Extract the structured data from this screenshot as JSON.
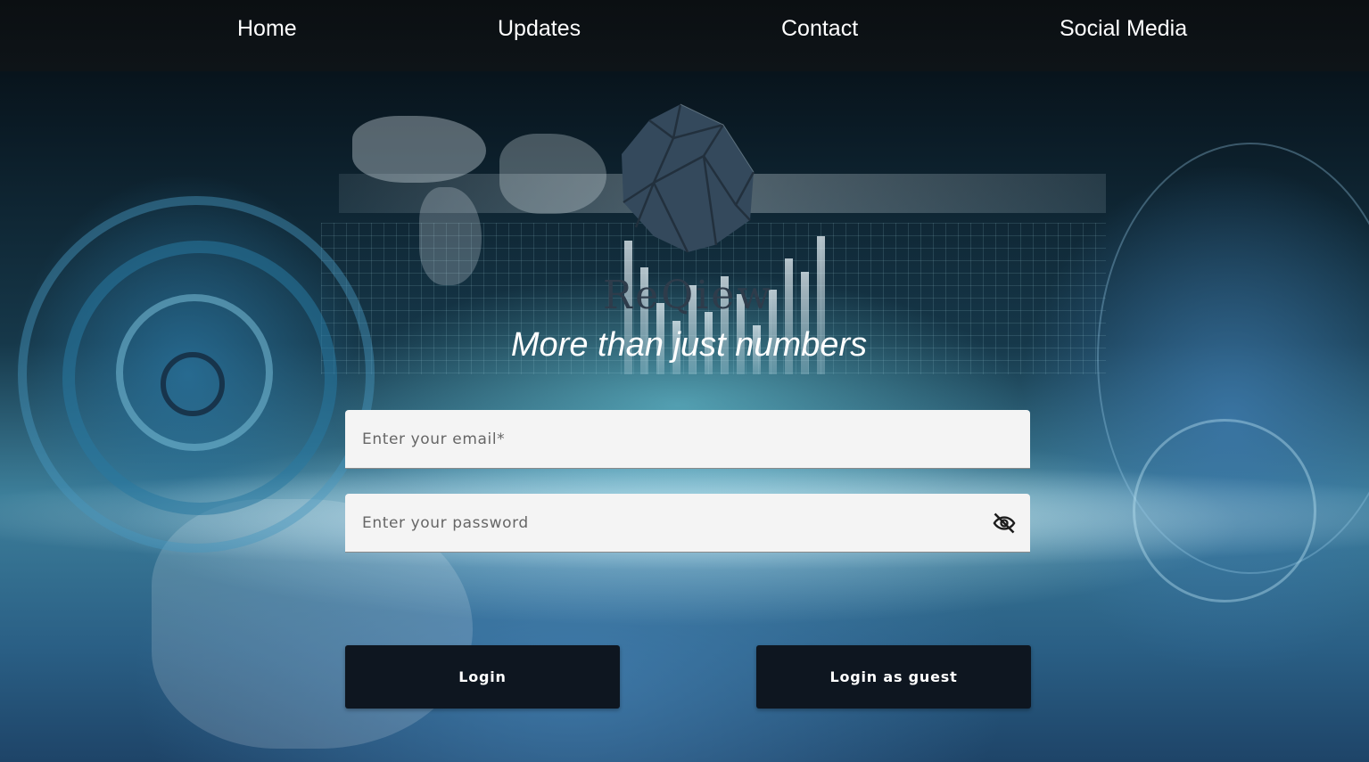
{
  "nav": {
    "items": [
      {
        "label": "Home"
      },
      {
        "label": "Updates"
      },
      {
        "label": "Contact"
      },
      {
        "label": "Social Media"
      }
    ]
  },
  "brand": {
    "name": "ReQiew",
    "tagline": "More than just numbers",
    "logo_icon": "faceted-hexagon-logo"
  },
  "login_form": {
    "email": {
      "placeholder": "Enter your email*",
      "value": ""
    },
    "password": {
      "placeholder": "Enter your password",
      "value": "",
      "toggle_icon": "eye-off-icon"
    },
    "login_label": "Login",
    "guest_label": "Login as guest"
  },
  "colors": {
    "nav_bg": "#0b0f12",
    "button_bg": "#0e1620",
    "field_bg": "#f4f4f4",
    "brand_text": "#2e3c4b"
  }
}
